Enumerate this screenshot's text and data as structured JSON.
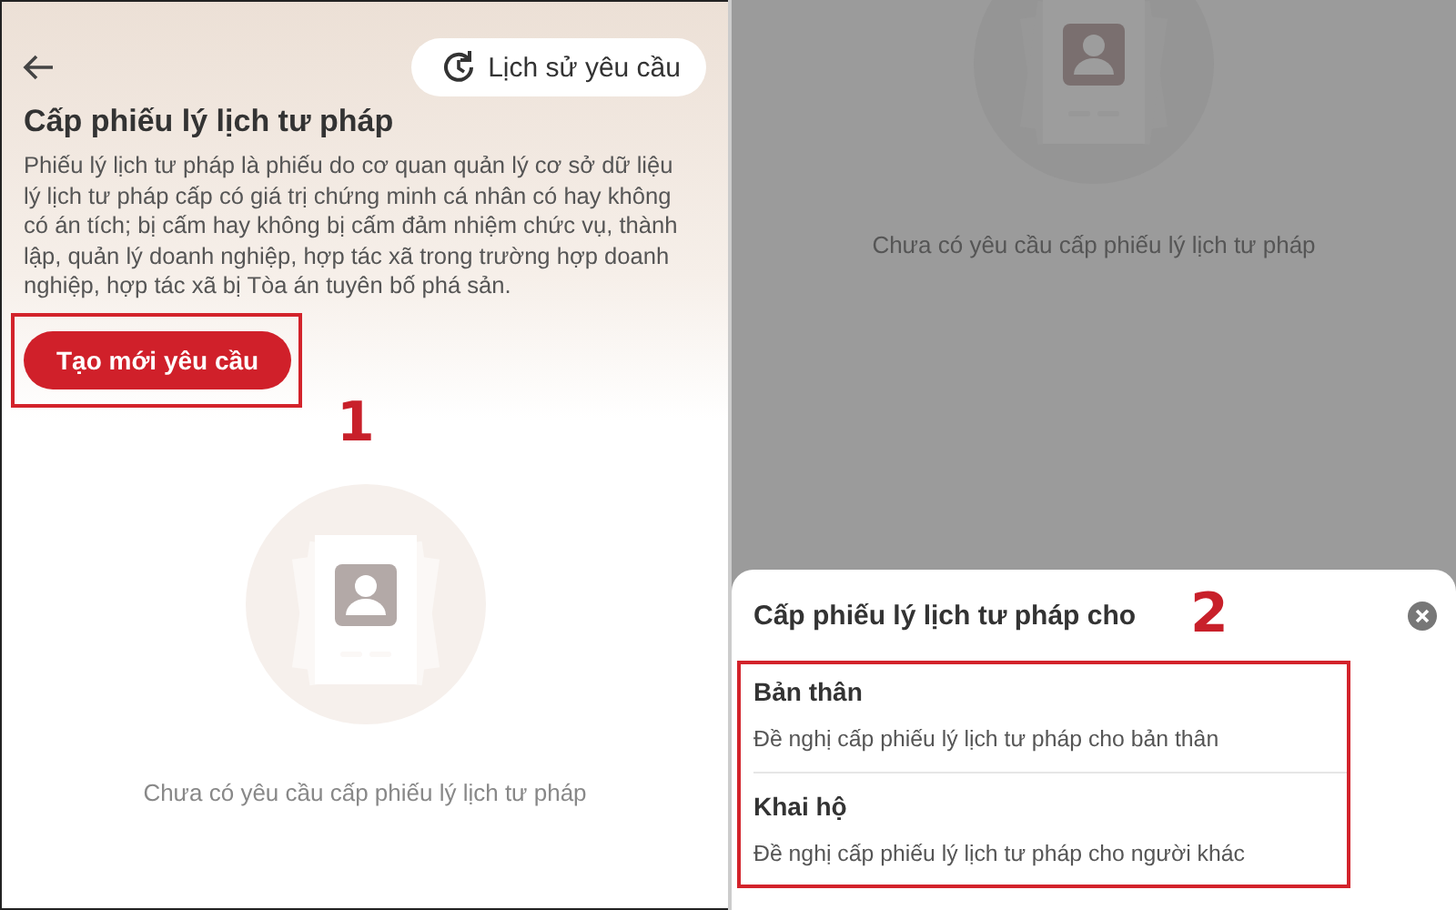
{
  "left_screen": {
    "history_button": {
      "label": "Lịch sử yêu cầu"
    },
    "title": "Cấp phiếu lý lịch tư pháp",
    "description": "Phiếu lý lịch tư pháp là phiếu do cơ quan quản lý cơ sở dữ liệu lý lịch tư pháp cấp có giá trị chứng minh cá nhân có hay không có án tích; bị cấm hay không bị cấm đảm nhiệm chức vụ, thành lập, quản lý doanh nghiệp, hợp tác xã trong trường hợp doanh nghiệp, hợp tác xã bị Tòa án tuyên bố phá sản.",
    "create_button": {
      "label": "Tạo mới yêu cầu"
    },
    "step_number": "1",
    "empty_message": "Chưa có yêu cầu cấp phiếu lý lịch tư pháp"
  },
  "right_screen": {
    "empty_message": "Chưa có yêu cầu cấp phiếu lý lịch tư pháp",
    "sheet": {
      "title": "Cấp phiếu lý lịch tư pháp cho",
      "step_number": "2",
      "options": [
        {
          "title": "Bản thân",
          "subtitle": "Đề nghị cấp phiếu lý lịch tư pháp cho bản thân"
        },
        {
          "title": "Khai hộ",
          "subtitle": "Đề nghị cấp phiếu lý lịch tư pháp cho người khác"
        }
      ]
    }
  }
}
